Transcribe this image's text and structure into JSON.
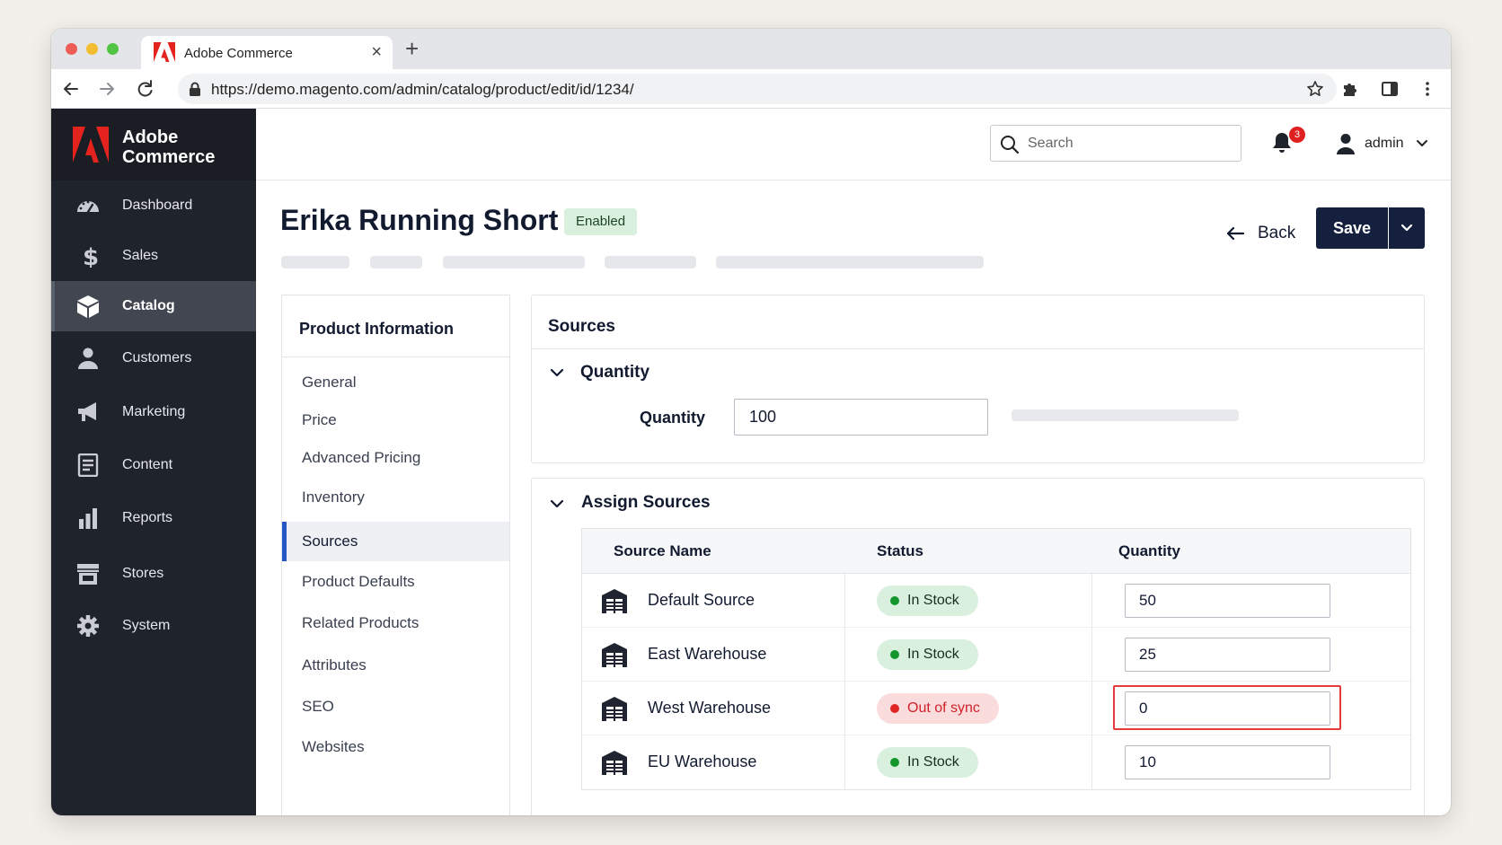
{
  "browser": {
    "tab_title": "Adobe Commerce",
    "url": "https://demo.magento.com/admin/catalog/product/edit/id/1234/"
  },
  "sidebar": {
    "brand": "Adobe Commerce",
    "brand_color": "#e4231f",
    "items": [
      {
        "label": "Dashboard",
        "icon": "dashboard-icon"
      },
      {
        "label": "Sales",
        "icon": "dollar-icon"
      },
      {
        "label": "Catalog",
        "icon": "box-icon",
        "active": true
      },
      {
        "label": "Customers",
        "icon": "person-icon"
      },
      {
        "label": "Marketing",
        "icon": "megaphone-icon"
      },
      {
        "label": "Content",
        "icon": "document-icon"
      },
      {
        "label": "Reports",
        "icon": "bar-chart-icon"
      },
      {
        "label": "Stores",
        "icon": "store-icon"
      },
      {
        "label": "System",
        "icon": "gear-icon"
      }
    ]
  },
  "header": {
    "search_placeholder": "Search",
    "notification_count": "3",
    "user": "admin"
  },
  "page": {
    "title": "Erika Running Short",
    "status": "Enabled",
    "back_label": "Back",
    "save_label": "Save"
  },
  "product_nav": {
    "title": "Product Information",
    "items": [
      {
        "label": "General"
      },
      {
        "label": "Price"
      },
      {
        "label": "Advanced Pricing"
      },
      {
        "label": "Inventory"
      },
      {
        "label": "Sources",
        "active": true
      },
      {
        "label": "Product Defaults"
      },
      {
        "label": "Related Products"
      },
      {
        "label": "Attributes"
      },
      {
        "label": "SEO"
      },
      {
        "label": "Websites"
      }
    ]
  },
  "sources": {
    "title": "Sources",
    "quantity_section": "Quantity",
    "quantity_label": "Quantity",
    "quantity_value": "100",
    "assign_section": "Assign Sources",
    "columns": [
      "Source Name",
      "Status",
      "Quantity"
    ],
    "rows": [
      {
        "name": "Default Source",
        "status": "In Stock",
        "quantity": "50"
      },
      {
        "name": "East Warehouse",
        "status": "In Stock",
        "quantity": "25"
      },
      {
        "name": "West Warehouse",
        "status": "Out of sync",
        "quantity": "0",
        "error": true
      },
      {
        "name": "EU Warehouse",
        "status": "In Stock",
        "quantity": "10"
      }
    ]
  }
}
